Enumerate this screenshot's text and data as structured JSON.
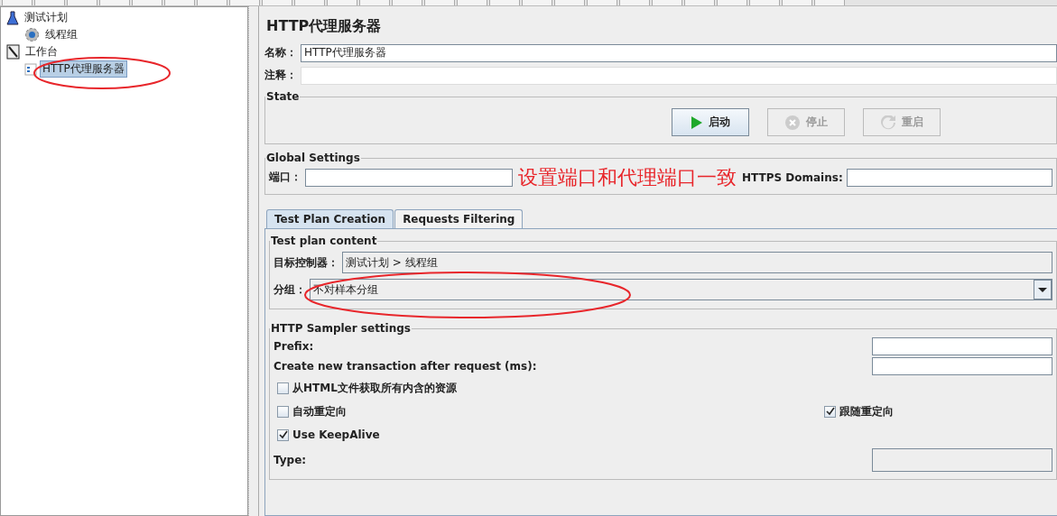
{
  "tree": [
    {
      "label": "测试计划",
      "kind": "plan",
      "selected": false,
      "children": [
        {
          "label": "线程组",
          "kind": "threads",
          "selected": false
        }
      ]
    },
    {
      "label": "工作台",
      "kind": "workbench",
      "selected": false,
      "children": [
        {
          "label": "HTTP代理服务器",
          "kind": "proxy",
          "selected": true
        }
      ]
    }
  ],
  "panel": {
    "title": "HTTP代理服务器",
    "name_label": "名称：",
    "name_value": "HTTP代理服务器",
    "comment_label": "注释：",
    "state": {
      "title": "State",
      "buttons": [
        {
          "label": "启动",
          "kind": "start",
          "disabled": false
        },
        {
          "label": "停止",
          "kind": "stop",
          "disabled": true
        },
        {
          "label": "重启",
          "kind": "restart",
          "disabled": true
        }
      ]
    },
    "global": {
      "title": "Global Settings",
      "port_label": "端口：",
      "https_label": "HTTPS Domains:"
    },
    "tabs": [
      {
        "label": "Test Plan Creation",
        "selected": true
      },
      {
        "label": "Requests Filtering",
        "selected": false
      }
    ],
    "content": {
      "title": "Test plan content",
      "target_label": "目标控制器：",
      "target_value": "测试计划 > 线程组",
      "group_label": "分组：",
      "group_value": "不对样本分组"
    },
    "sampler": {
      "title": "HTTP Sampler settings",
      "prefix_label": "Prefix:",
      "transaction_label": "Create new transaction after request (ms):",
      "option_rows": [
        [
          {
            "label": "从HTML文件获取所有内含的资源",
            "checked": false
          }
        ],
        [
          {
            "label": "自动重定向",
            "checked": false
          },
          {
            "label": "跟随重定向",
            "checked": true
          }
        ],
        [
          {
            "label": "Use KeepAlive",
            "checked": true
          }
        ]
      ],
      "type_label": "Type:"
    }
  },
  "annotation": {
    "note": "设置端口和代理端口一致"
  }
}
